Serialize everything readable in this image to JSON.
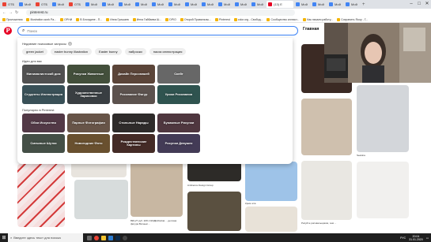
{
  "browser": {
    "tabs": [
      {
        "label": "ОТБ",
        "color": "#ea4335"
      },
      {
        "label": "Мой",
        "color": "#4285f4"
      },
      {
        "label": "ОТБ",
        "color": "#ea4335"
      },
      {
        "label": "Мой",
        "color": "#4285f4"
      },
      {
        "label": "ОТБ",
        "color": "#ea4335"
      },
      {
        "label": "Мой",
        "color": "#4285f4"
      },
      {
        "label": "Мой",
        "color": "#4285f4"
      },
      {
        "label": "Мой",
        "color": "#4285f4"
      },
      {
        "label": "Мой",
        "color": "#4285f4"
      },
      {
        "label": "Мой",
        "color": "#4285f4"
      },
      {
        "label": "Мой",
        "color": "#4285f4"
      },
      {
        "label": "Мой",
        "color": "#4285f4"
      },
      {
        "label": "Мой",
        "color": "#4285f4"
      },
      {
        "label": "Мой",
        "color": "#4285f4"
      },
      {
        "label": "Мой",
        "color": "#4285f4"
      },
      {
        "label": "Мой",
        "color": "#4285f4"
      },
      {
        "label": "Мой",
        "color": "#4285f4"
      },
      {
        "label": "Мой",
        "color": "#4285f4"
      },
      {
        "label": "Мой",
        "color": "#4285f4"
      },
      {
        "label": "Мой",
        "color": "#4285f4"
      }
    ],
    "active_tab": "(13) Е",
    "new_tab": "+",
    "url": "pinterest.ru",
    "bookmarks": [
      "Приложения",
      "Illustration-work Pa...",
      "ОРНИ",
      "В Блондине - П...",
      "Инна Гришаев",
      "Инна Гайбаева Ш...",
      "DPIO",
      "Открой Правильны...",
      "Pinterest",
      "color.org - Свобод...",
      "Сообщество иллюст...",
      "Как начали работу...",
      "Сохранить Яооу - Г..."
    ]
  },
  "header": {
    "logo": "P",
    "search_placeholder": "Поиск",
    "home_label": "Главная"
  },
  "dropdown": {
    "recent_title": "Недавние поисковые запросы",
    "recent_chips": [
      "green jacket",
      "easter bunny illustration",
      "Easter bunny",
      "наброски",
      "пасха иллюстрация"
    ],
    "ideas_title": "Идеи для вас",
    "ideas": [
      {
        "label": "Минималистский дом",
        "color": "#6b6b6b"
      },
      {
        "label": "Рисунки Животные",
        "color": "#5a6a4f"
      },
      {
        "label": "Дизайн Персонажей",
        "color": "#7a5d4c"
      },
      {
        "label": "Скейт",
        "color": "#8a8a8a"
      },
      {
        "label": "Студенты Иллюстрация",
        "color": "#4d6b74"
      },
      {
        "label": "Художественные Зарисовки",
        "color": "#4c5358"
      },
      {
        "label": "Рисование Фигур",
        "color": "#7b6e68"
      },
      {
        "label": "Уроки Рисования",
        "color": "#3f6f6a"
      }
    ],
    "popular_title": "Популярно в Pinterest",
    "popular": [
      {
        "label": "Обои Искусство",
        "color": "#6e4c5e"
      },
      {
        "label": "Парные Фотографии",
        "color": "#8a7060"
      },
      {
        "label": "Стильные Наряды",
        "color": "#3e3a38"
      },
      {
        "label": "Бумажные Рисунки",
        "color": "#6a4a55"
      },
      {
        "label": "Смешные Шутки",
        "color": "#5b6a5e"
      },
      {
        "label": "Новогодние Фото",
        "color": "#8c6b3f"
      },
      {
        "label": "Рождественские Картины",
        "color": "#5b3a33"
      },
      {
        "label": "Рисунки Девушек",
        "color": "#5a4f73"
      }
    ]
  },
  "pins": {
    "texts": [
      "Ambience Design Group",
      "Крем шта",
      "Seekina",
      "Рисуйте рисовальщиков, чем ...",
      "Pixelfun work",
      "899,27 руб. 20% СКИДКАNobat ... детская фигура Ватным ..."
    ]
  },
  "taskbar": {
    "search_placeholder": "Введите здесь текст для поиска",
    "time": "20:04",
    "date": "31.01.2020",
    "lang": "РУС"
  }
}
